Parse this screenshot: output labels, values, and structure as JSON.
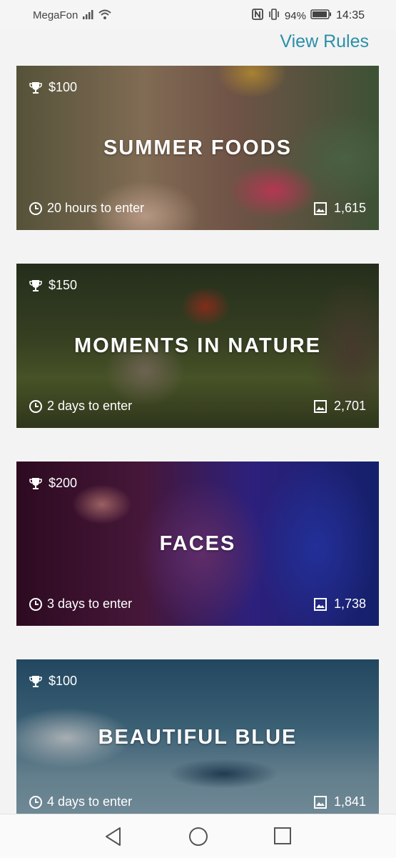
{
  "status_bar": {
    "carrier": "MegaFon",
    "battery": "94%",
    "time": "14:35"
  },
  "header": {
    "view_rules_label": "View Rules",
    "accent_color": "#2a8fa8"
  },
  "challenges": [
    {
      "prize": "$100",
      "title": "SUMMER FOODS",
      "deadline": "20 hours to enter",
      "entries": "1,615"
    },
    {
      "prize": "$150",
      "title": "MOMENTS IN NATURE",
      "deadline": "2 days to enter",
      "entries": "2,701"
    },
    {
      "prize": "$200",
      "title": "FACES",
      "deadline": "3 days to enter",
      "entries": "1,738"
    },
    {
      "prize": "$100",
      "title": "BEAUTIFUL BLUE",
      "deadline": "4 days to enter",
      "entries": "1,841"
    }
  ],
  "icons": {
    "prize": "trophy-icon",
    "deadline": "clock-icon",
    "entries": "image-icon",
    "nav": [
      "back-icon",
      "home-icon",
      "recents-icon"
    ]
  }
}
